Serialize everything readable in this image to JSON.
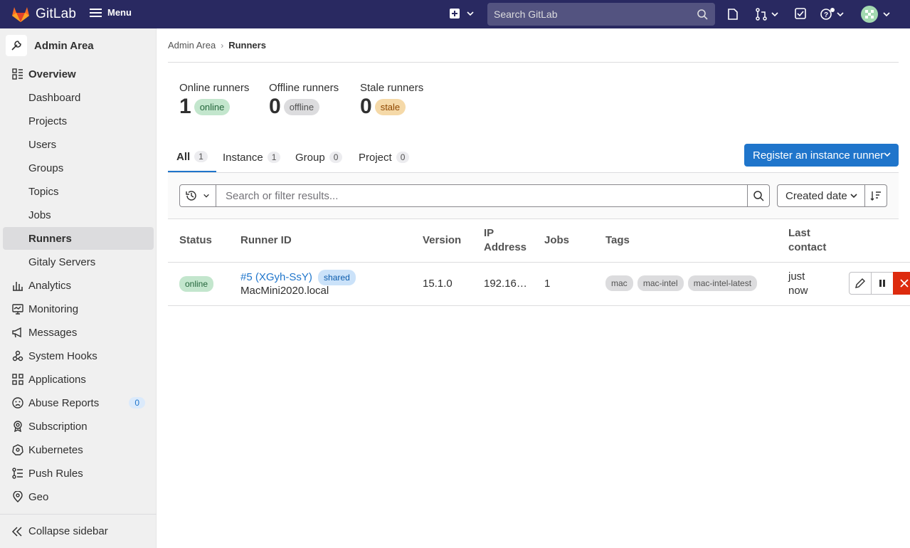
{
  "topbar": {
    "brand": "GitLab",
    "menu_label": "Menu",
    "search_placeholder": "Search GitLab"
  },
  "sidebar": {
    "context_title": "Admin Area",
    "items": [
      {
        "label": "Overview",
        "icon": "overview-icon"
      },
      {
        "label": "Dashboard"
      },
      {
        "label": "Projects"
      },
      {
        "label": "Users"
      },
      {
        "label": "Groups"
      },
      {
        "label": "Topics"
      },
      {
        "label": "Jobs"
      },
      {
        "label": "Runners"
      },
      {
        "label": "Gitaly Servers"
      },
      {
        "label": "Analytics",
        "icon": "analytics-icon"
      },
      {
        "label": "Monitoring",
        "icon": "monitoring-icon"
      },
      {
        "label": "Messages",
        "icon": "messages-icon"
      },
      {
        "label": "System Hooks",
        "icon": "hook-icon"
      },
      {
        "label": "Applications",
        "icon": "applications-icon"
      },
      {
        "label": "Abuse Reports",
        "icon": "abuse-icon",
        "count": "0"
      },
      {
        "label": "Subscription",
        "icon": "subscription-icon"
      },
      {
        "label": "Kubernetes",
        "icon": "kubernetes-icon"
      },
      {
        "label": "Push Rules",
        "icon": "push-rules-icon"
      },
      {
        "label": "Geo",
        "icon": "geo-icon"
      }
    ],
    "collapse_label": "Collapse sidebar"
  },
  "breadcrumb": {
    "parent": "Admin Area",
    "current": "Runners"
  },
  "stats": [
    {
      "label": "Online runners",
      "value": "1",
      "badge": "online"
    },
    {
      "label": "Offline runners",
      "value": "0",
      "badge": "offline"
    },
    {
      "label": "Stale runners",
      "value": "0",
      "badge": "stale"
    }
  ],
  "tabs": [
    {
      "label": "All",
      "count": "1"
    },
    {
      "label": "Instance",
      "count": "1"
    },
    {
      "label": "Group",
      "count": "0"
    },
    {
      "label": "Project",
      "count": "0"
    }
  ],
  "register_button": "Register an instance runner",
  "filter": {
    "placeholder": "Search or filter results...",
    "sort_label": "Created date"
  },
  "table": {
    "headers": [
      "Status",
      "Runner ID",
      "Version",
      "IP",
      "Address",
      "Jobs",
      "Tags",
      "Last",
      "contact"
    ],
    "row": {
      "status": "online",
      "runner_id": "#5 (XGyh-SsY)",
      "runner_type": "shared",
      "description": "MacMini2020.local",
      "version": "15.1.0",
      "ip": "192.16…",
      "jobs": "1",
      "tags": [
        "mac",
        "mac-intel",
        "mac-intel-latest"
      ],
      "last_contact_1": "just",
      "last_contact_2": "now"
    }
  },
  "colors": {
    "topbar": "#292961",
    "primary": "#1f75cb",
    "danger": "#dd2b0e"
  }
}
